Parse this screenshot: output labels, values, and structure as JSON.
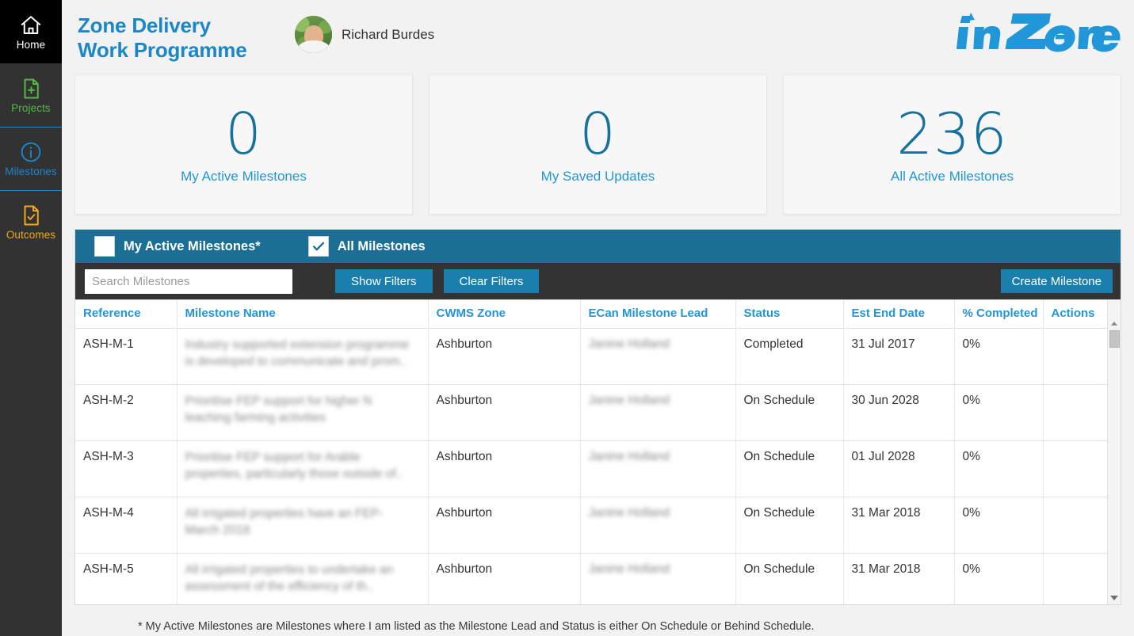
{
  "sidebar": {
    "items": [
      {
        "label": "Home",
        "icon": "home-icon",
        "key": "home"
      },
      {
        "label": "Projects",
        "icon": "document-plus-icon",
        "key": "projects"
      },
      {
        "label": "Milestones",
        "icon": "info-circle-icon",
        "key": "milestones"
      },
      {
        "label": "Outcomes",
        "icon": "document-check-icon",
        "key": "outcomes"
      }
    ],
    "colors": {
      "home": "#ffffff",
      "projects": "#56b848",
      "milestones": "#1b87c9",
      "outcomes": "#f0a81e"
    }
  },
  "header": {
    "title_line1": "Zone Delivery",
    "title_line2": "Work Programme",
    "user_name": "Richard Burdes",
    "brand": "inZone",
    "brand_color": "#2196d8",
    "title_color": "#1b87c9"
  },
  "cards": [
    {
      "value": "0",
      "label": "My Active Milestones"
    },
    {
      "value": "0",
      "label": "My Saved Updates"
    },
    {
      "value": "236",
      "label": "All Active Milestones"
    }
  ],
  "filters": {
    "my_active_label": "My Active Milestones*",
    "my_active_checked": false,
    "all_label": "All Milestones",
    "all_checked": true,
    "search_placeholder": "Search Milestones",
    "search_value": "",
    "show_filters_label": "Show Filters",
    "clear_filters_label": "Clear Filters",
    "create_label": "Create Milestone",
    "bar_color": "#1b6e94",
    "button_color": "#1b7fae"
  },
  "table": {
    "columns": [
      "Reference",
      "Milestone Name",
      "CWMS Zone",
      "ECan Milestone Lead",
      "Status",
      "Est End Date",
      "% Completed",
      "Actions"
    ],
    "rows": [
      {
        "reference": "ASH-M-1",
        "name": "Industry supported extension programme is developed to communicate and prom..",
        "zone": "Ashburton",
        "lead": "Janine Holland",
        "status": "Completed",
        "est_end_date": "31 Jul 2017",
        "completed": "0%",
        "actions": ""
      },
      {
        "reference": "ASH-M-2",
        "name": "Prioritise FEP support for higher N leaching farming activities",
        "zone": "Ashburton",
        "lead": "Janine Holland",
        "status": "On Schedule",
        "est_end_date": "30 Jun 2028",
        "completed": "0%",
        "actions": ""
      },
      {
        "reference": "ASH-M-3",
        "name": "Prioritise FEP support for Arable properties, particularly those outside of..",
        "zone": "Ashburton",
        "lead": "Janine Holland",
        "status": "On Schedule",
        "est_end_date": "01 Jul 2028",
        "completed": "0%",
        "actions": ""
      },
      {
        "reference": "ASH-M-4",
        "name": "All irrigated properties have an FEP- March 2018",
        "zone": "Ashburton",
        "lead": "Janine Holland",
        "status": "On Schedule",
        "est_end_date": "31 Mar 2018",
        "completed": "0%",
        "actions": ""
      },
      {
        "reference": "ASH-M-5",
        "name": "All irrigated properties to undertake an assessment of the efficiency of th..",
        "zone": "Ashburton",
        "lead": "Janine Holland",
        "status": "On Schedule",
        "est_end_date": "31 Mar 2018",
        "completed": "0%",
        "actions": ""
      }
    ]
  },
  "footnote": "* My Active Milestones are Milestones where I am listed as the Milestone Lead and Status is either On Schedule or Behind Schedule."
}
